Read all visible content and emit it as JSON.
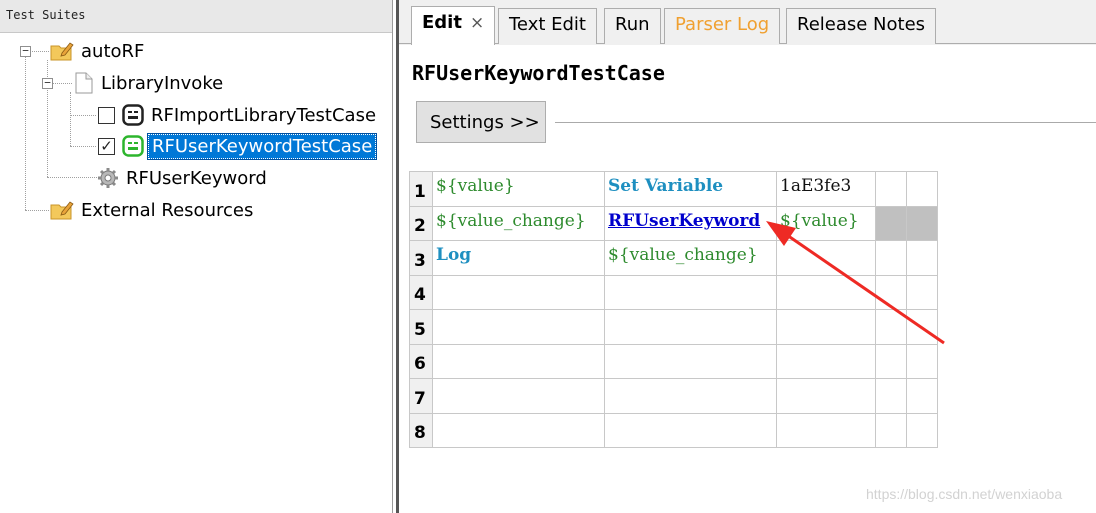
{
  "tree": {
    "header": "Test Suites",
    "nodes": {
      "root": "autoRF",
      "library_invoke": "LibraryInvoke",
      "test_case_1": "RFImportLibraryTestCase",
      "test_case_2": "RFUserKeywordTestCase",
      "user_keyword": "RFUserKeyword",
      "external": "External Resources"
    },
    "checkbox_1_checked": false,
    "checkbox_2_checked": true,
    "check_mark": "✓"
  },
  "tabs": {
    "edit": "Edit",
    "close": "×",
    "text_edit": "Text Edit",
    "run": "Run",
    "parser_log": "Parser Log",
    "release_notes": "Release Notes"
  },
  "editor": {
    "title": "RFUserKeywordTestCase",
    "settings_label": "Settings >>",
    "row_numbers": [
      "1",
      "2",
      "3",
      "4",
      "5",
      "6",
      "7",
      "8"
    ],
    "rows": [
      [
        "${value}",
        "Set Variable",
        "1aE3fe3",
        "",
        ""
      ],
      [
        "${value_change}",
        "RFUserKeyword",
        "${value}",
        "",
        ""
      ],
      [
        "Log",
        "${value_change}",
        "",
        "",
        ""
      ]
    ]
  },
  "colors": {
    "selection": "#0078d7",
    "variable": "#2e8b2e",
    "keyword": "#1e8fc0",
    "user_keyword": "#0000cc",
    "parser_log": "#f0a030",
    "arrow": "#ee2a24"
  },
  "watermark": "https://blog.csdn.net/wenxiaoba"
}
